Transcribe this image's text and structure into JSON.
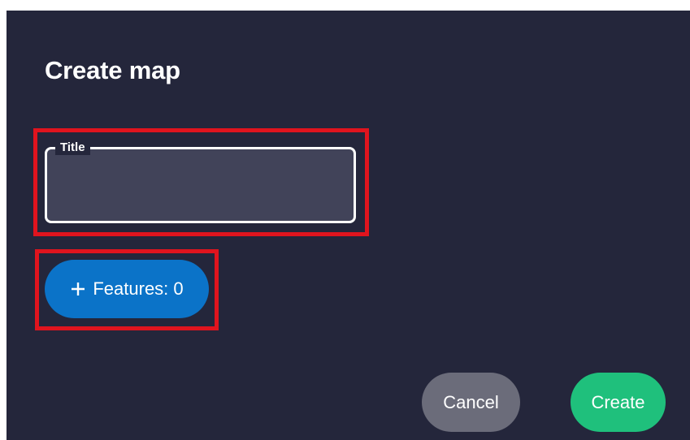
{
  "dialog": {
    "title": "Create map",
    "title_field": {
      "label": "Title",
      "value": "",
      "placeholder": ""
    },
    "features_button": {
      "icon": "plus-icon",
      "label": "Features: 0"
    },
    "cancel_label": "Cancel",
    "create_label": "Create"
  },
  "colors": {
    "dialog_background": "#24263b",
    "field_background": "#414359",
    "features_button": "#0b73c8",
    "cancel_button": "#6b6c7a",
    "create_button": "#1fc07c",
    "highlight": "#e0141e"
  }
}
